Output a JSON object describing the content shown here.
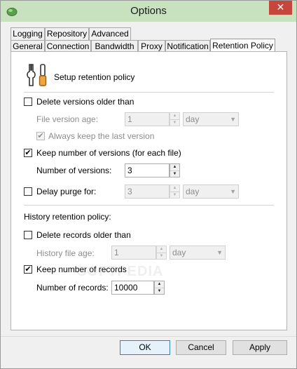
{
  "window": {
    "title": "Options",
    "close_glyph": "✕"
  },
  "tabs": {
    "row1": [
      "Logging",
      "Repository",
      "Advanced"
    ],
    "row2": [
      "General",
      "Connection",
      "Bandwidth",
      "Proxy",
      "Notification",
      "Retention Policy"
    ],
    "active": "Retention Policy"
  },
  "header": {
    "icon": "tools-icon",
    "text": "Setup retention policy"
  },
  "delete_versions": {
    "label": "Delete versions older than",
    "checked": false,
    "age_label": "File version age:",
    "age_value": "1",
    "age_unit": "day",
    "keep_last_label": "Always keep the last version",
    "keep_last_checked": true
  },
  "keep_versions": {
    "label": "Keep number of versions (for each file)",
    "checked": true,
    "count_label": "Number of versions:",
    "count_value": "3"
  },
  "delay_purge": {
    "label": "Delay purge for:",
    "checked": false,
    "value": "3",
    "unit": "day"
  },
  "history": {
    "section_label": "History retention policy:",
    "delete_label": "Delete records older than",
    "delete_checked": false,
    "age_label": "History file age:",
    "age_value": "1",
    "age_unit": "day",
    "keep_label": "Keep number of records",
    "keep_checked": true,
    "records_label": "Number of records:",
    "records_value": "10000"
  },
  "buttons": {
    "ok": "OK",
    "cancel": "Cancel",
    "apply": "Apply"
  },
  "watermark": "SOFTPEDIA",
  "colors": {
    "titlebar": "#c8e2c0",
    "close": "#c7463c",
    "default_button_border": "#3c7fb1"
  }
}
